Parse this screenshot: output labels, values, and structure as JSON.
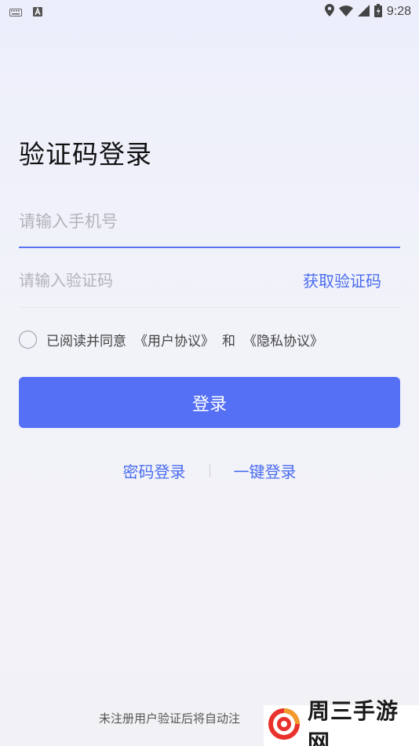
{
  "status_bar": {
    "time": "9:28",
    "icons": [
      "keyboard-icon",
      "app-a-icon",
      "location-icon",
      "wifi-icon",
      "signal-icon",
      "battery-icon"
    ]
  },
  "page": {
    "title": "验证码登录"
  },
  "form": {
    "phone_placeholder": "请输入手机号",
    "code_placeholder": "请输入验证码",
    "get_code_label": "获取验证码",
    "agree_prefix": "已阅读并同意",
    "user_agreement": "《用户协议》",
    "and_text": "和",
    "privacy_agreement": "《隐私协议》",
    "login_label": "登录"
  },
  "alt_login": {
    "password_login": "密码登录",
    "one_click_login": "一键登录"
  },
  "footer": {
    "text": "未注册用户验证后将自动注"
  },
  "watermark": {
    "text": "周三手游网"
  },
  "colors": {
    "accent": "#5570f5",
    "link": "#4a6cf0",
    "input_underline": "#5a73ee"
  }
}
